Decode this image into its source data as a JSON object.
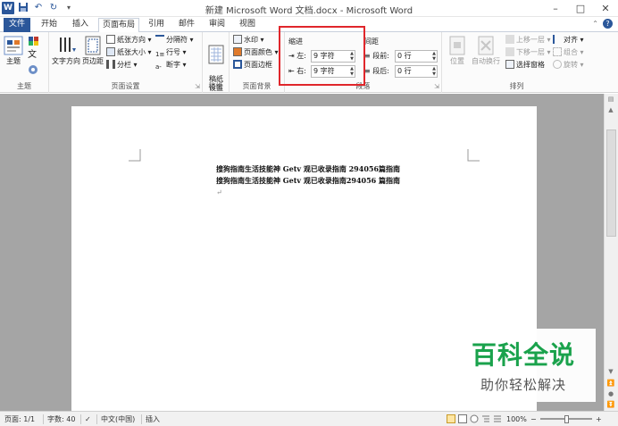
{
  "window": {
    "title": "新建 Microsoft Word 文档.docx - Microsoft Word",
    "controls": [
      "–",
      "□",
      "✕"
    ],
    "app_icon": "W"
  },
  "tabs": [
    {
      "label": "文件"
    },
    {
      "label": "开始"
    },
    {
      "label": "插入"
    },
    {
      "label": "页面布局"
    },
    {
      "label": "引用"
    },
    {
      "label": "邮件"
    },
    {
      "label": "审阅"
    },
    {
      "label": "视图"
    }
  ],
  "ribbon": {
    "theme": {
      "themes": "主题",
      "group": "主题"
    },
    "page_setup": {
      "text_direction": "文字方向",
      "margins": "页边距",
      "orientation": "纸张方向",
      "size": "纸张大小",
      "columns": "分栏",
      "breaks": "分隔符",
      "line_numbers": "行号",
      "hyphenation": "断字",
      "group": "页面设置"
    },
    "draft": {
      "button": "稿纸\n设置",
      "group": "稿纸"
    },
    "background": {
      "watermark": "水印",
      "page_color": "页面颜色",
      "page_borders": "页面边框",
      "group": "页面背景"
    },
    "paragraph": {
      "indent_title": "缩进",
      "left_label": "左:",
      "left_value": "9 字符",
      "right_label": "右:",
      "right_value": "9 字符",
      "spacing_title": "间距",
      "before_label": "段前:",
      "before_value": "0 行",
      "after_label": "段后:",
      "after_value": "0 行",
      "group": "段落"
    },
    "arrange": {
      "position": "位置",
      "wrap": "自动换行",
      "forward": "上移一层",
      "backward": "下移一层",
      "selection_pane": "选择窗格",
      "align": "对齐",
      "group_objects": "组合",
      "rotate": "旋转",
      "group": "排列"
    }
  },
  "document": {
    "text": "搜狗指南生活技能神 Getv 观已收录指南 294056篇指南搜狗指南生活技能神 Getv 观已收录指南294056 篇指南",
    "paragraph_mark": "↵"
  },
  "statusbar": {
    "page": "页面: 1/1",
    "words": "字数: 40",
    "language": "中文(中国)",
    "mode": "插入",
    "zoom": "100%",
    "zoom_minus": "−",
    "zoom_plus": "+"
  },
  "watermark": {
    "title": "百科全说",
    "subtitle": "助你轻松解决"
  },
  "colors": {
    "accent": "#2b579a",
    "highlight": "#e0262b",
    "brand_green": "#1aa24c"
  }
}
